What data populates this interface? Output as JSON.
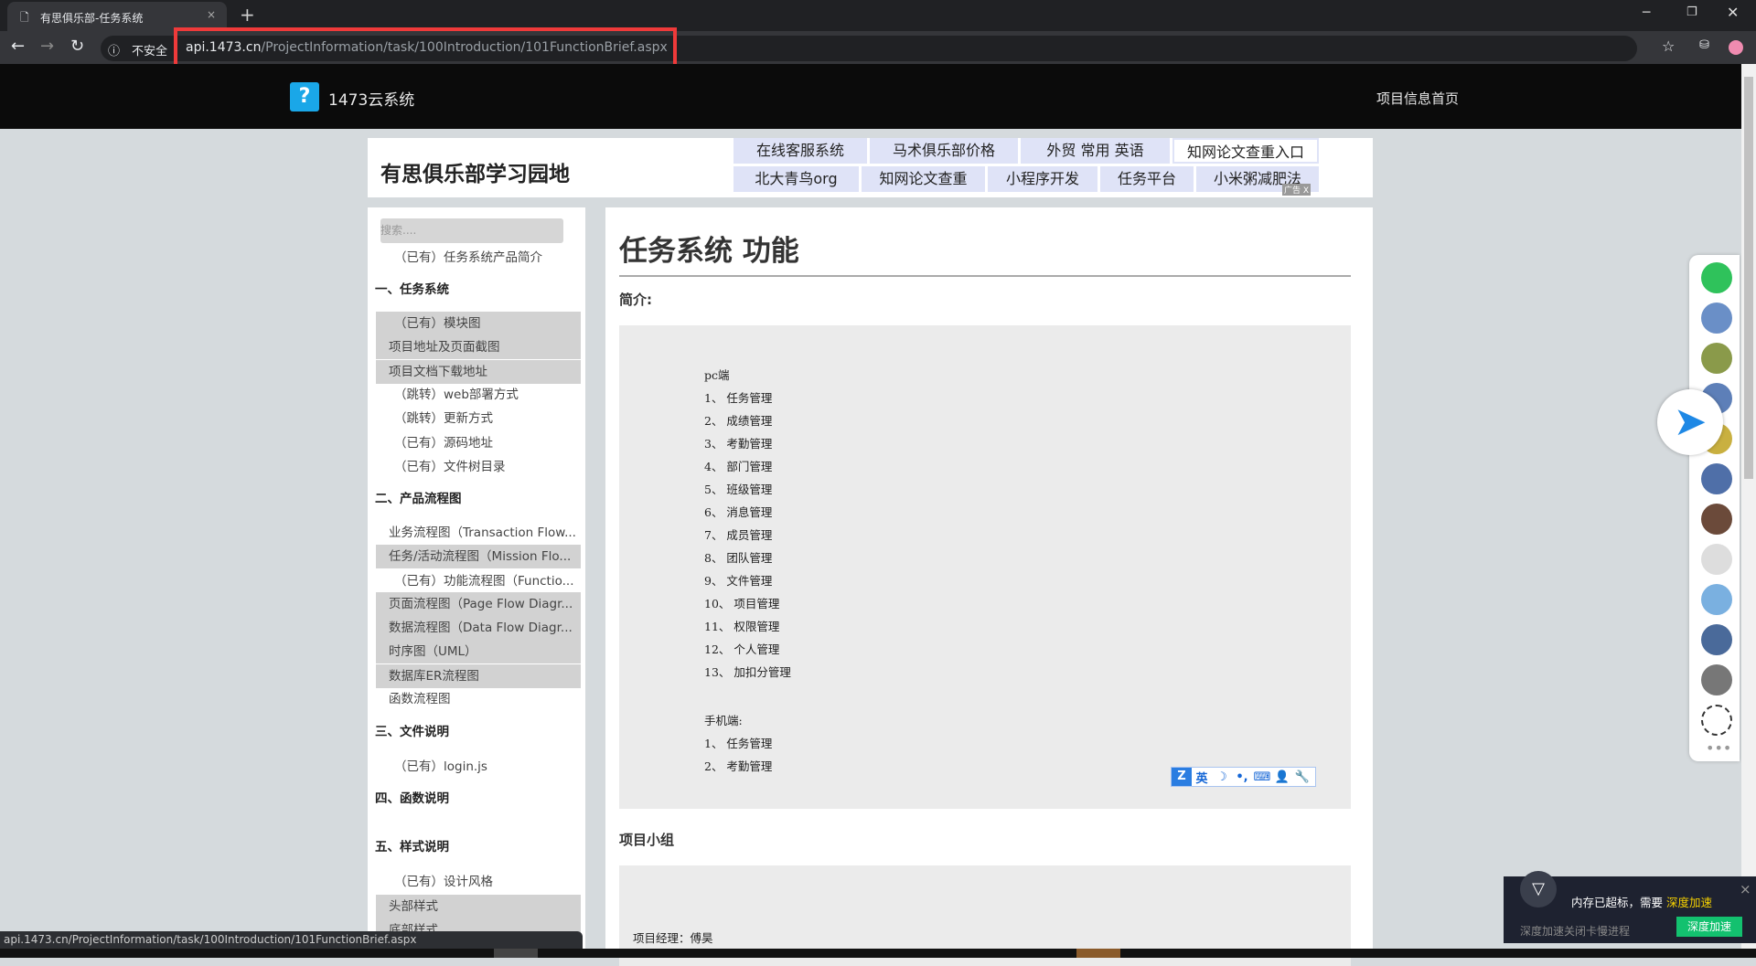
{
  "browser": {
    "tab_title": "有思俱乐部-任务系统",
    "new_tab": "+",
    "close": "×",
    "security": "不安全",
    "url_host": "api.1473.cn",
    "url_path": "/ProjectInformation/task/100Introduction/101FunctionBrief.aspx",
    "status_url": "api.1473.cn/ProjectInformation/task/100Introduction/101FunctionBrief.aspx"
  },
  "header": {
    "logo_text": "1473云系统",
    "nav_link": "项目信息首页",
    "accent": "#1aa7e8"
  },
  "brand": {
    "title": "有思俱乐部学习园地",
    "ad_mark": "广告 X",
    "links": [
      "在线客服系统",
      "马术俱乐部价格",
      "外贸 常用 英语",
      "知网论文查重入口",
      "北大青鸟org",
      "知网论文查重",
      "小程序开发",
      "任务平台",
      "小米粥减肥法"
    ]
  },
  "sidebar": {
    "search_placeholder": "搜索....",
    "items": [
      {
        "label": "（已有）任务系统产品简介"
      },
      {
        "label": "一、任务系统"
      },
      {
        "label": "（已有）模块图"
      },
      {
        "label": "项目地址及页面截图"
      },
      {
        "label": "项目文档下载地址"
      },
      {
        "label": "（跳转）web部署方式"
      },
      {
        "label": "（跳转）更新方式"
      },
      {
        "label": "（已有）源码地址"
      },
      {
        "label": "（已有）文件树目录"
      },
      {
        "label": "二、产品流程图"
      },
      {
        "label": "业务流程图（Transaction Flow..."
      },
      {
        "label": "任务/活动流程图（Mission Flo..."
      },
      {
        "label": "（已有）功能流程图（Functio..."
      },
      {
        "label": "页面流程图（Page Flow Diagr..."
      },
      {
        "label": "数据流程图（Data Flow Diagr..."
      },
      {
        "label": "时序图（UML）"
      },
      {
        "label": "数据库ER流程图"
      },
      {
        "label": "函数流程图"
      },
      {
        "label": "三、文件说明"
      },
      {
        "label": "（已有）login.js"
      },
      {
        "label": "四、函数说明"
      },
      {
        "label": "五、样式说明"
      },
      {
        "label": "（已有）设计风格"
      },
      {
        "label": "头部样式"
      },
      {
        "label": "底部样式"
      }
    ]
  },
  "main": {
    "title": "任务系统 功能",
    "intro_label": "简介:",
    "pc_heading": "pc端",
    "pc_items": [
      "1、 任务管理",
      "2、 成绩管理",
      "3、 考勤管理",
      "4、 部门管理",
      "5、 班级管理",
      "6、 消息管理",
      "7、 成员管理",
      "8、 团队管理",
      "9、 文件管理",
      "10、 项目管理",
      "11、 权限管理",
      "12、 个人管理",
      "13、 加扣分管理"
    ],
    "mobile_heading": "手机端:",
    "mobile_items": [
      "1、 任务管理",
      "2、 考勤管理"
    ],
    "team_label": "项目小组",
    "manager": "项目经理：傅昊"
  },
  "ime": {
    "items": [
      "英",
      "☽",
      "•,",
      "⌨",
      "👤",
      "🔧"
    ]
  },
  "notification": {
    "text": "内存已超标，需要",
    "highlight": "深度加速",
    "sub": "深度加速关闭卡慢进程",
    "button": "深度加速",
    "close": "×"
  }
}
